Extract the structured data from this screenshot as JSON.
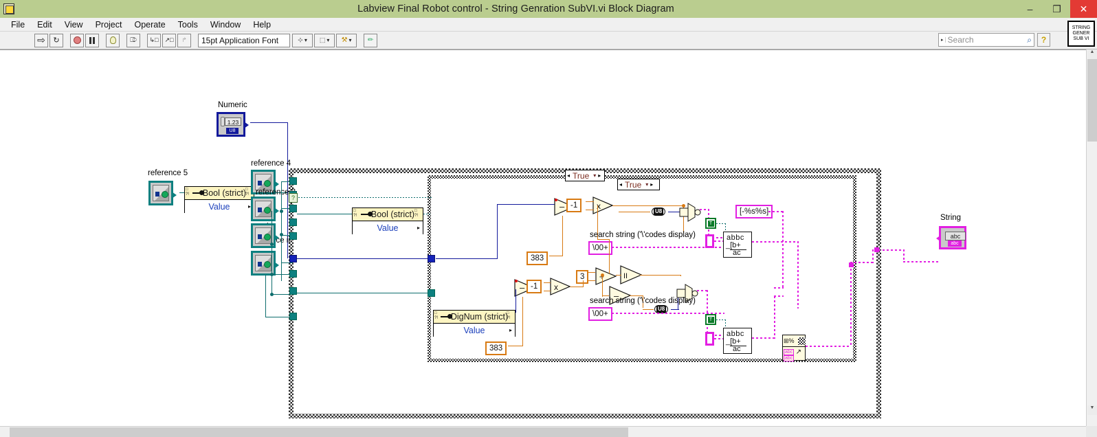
{
  "window": {
    "title": "Labview Final Robot control - String Genration SubVI.vi Block Diagram",
    "minimize": "–",
    "maximize": "❐",
    "close": "✕",
    "app_icon": "labview-vi-icon"
  },
  "menu": {
    "items": [
      "File",
      "Edit",
      "View",
      "Project",
      "Operate",
      "Tools",
      "Window",
      "Help"
    ]
  },
  "toolbar": {
    "run_label": "⇨",
    "run_continuous_label": "↻",
    "abort_label": "",
    "pause_label": "",
    "highlight_label": "",
    "retain_values_label": "",
    "step_into_label": "↳□",
    "step_over_label": "↗□",
    "step_out_label": "↱",
    "font_label": "15pt Application Font",
    "font_caret": "▾",
    "align_label": "⊹",
    "distribute_label": "⬚",
    "resize_label": "↺",
    "reorder_label": "⚒",
    "caret": "▾"
  },
  "search": {
    "placeholder": "Search",
    "dropdown_caret": "▸",
    "magnifier": "⌕",
    "help_label": "?"
  },
  "vi_icon": {
    "line1": "STRING",
    "line2": "GENER",
    "line3": "SUB VI"
  },
  "diagram": {
    "labels": {
      "numeric": "Numeric",
      "reference5": "reference 5",
      "reference4": "reference 4",
      "reference3": "reference 3",
      "reference_in": "in",
      "reference_ii": "reference ii",
      "string_out": "String",
      "search_string_top": "search string ('\\'codes display)",
      "search_string_bottom": "search string ('\\'codes display)"
    },
    "terminals": {
      "numeric_value": "1.23",
      "numeric_rep": "U8",
      "string_value": "abc",
      "string_rep": "abc"
    },
    "property_nodes": [
      {
        "title": "Bool (strict)",
        "property": "Value",
        "marks": "⬚\n?!"
      },
      {
        "title": "Bool (strict)",
        "property": "Value",
        "marks": "⬚\n?!"
      },
      {
        "title": "DigNum (strict)",
        "property": "Value",
        "marks": "⬚\n?!"
      }
    ],
    "case_structures": [
      {
        "selector": "True",
        "left_arrow": "◂",
        "right_arrow": "▸",
        "caret": "▾"
      },
      {
        "selector": "True",
        "left_arrow": "◂",
        "right_arrow": "▸",
        "caret": "▾"
      }
    ],
    "constants": {
      "offset_top": "383",
      "offset_bottom": "383",
      "minus_one_top": "-1",
      "minus_one_bottom": "-1",
      "divisor": "3",
      "format_string": "[-%s%s]",
      "search_const_top": "\\00+",
      "search_const_bottom": "\\00+",
      "bool_true_top": "T",
      "bool_true_bottom": "T",
      "u8_cast_top": "U8",
      "u8_cast_bottom": "U8"
    },
    "operators": {
      "subtract": "–",
      "multiply": "x",
      "divide": "÷",
      "quotient": "II",
      "negate": "–"
    },
    "functions": {
      "replace_substring_top": "abbc _[b+ ac",
      "replace_substring_bottom": "abbc _[b+ ac",
      "number_to_string_top": "number-to-decimal-string",
      "number_to_string_bottom": "number-to-decimal-string",
      "format_into_string": "Format Into String"
    },
    "colors": {
      "reference_wire": "#0d6d6d",
      "numeric_wire": "#12199b",
      "orange_wire": "#d87a13",
      "string_wire": "#e21fe2",
      "boolean_green": "#0a7a28",
      "loop_border": "#2b2b2b"
    }
  }
}
